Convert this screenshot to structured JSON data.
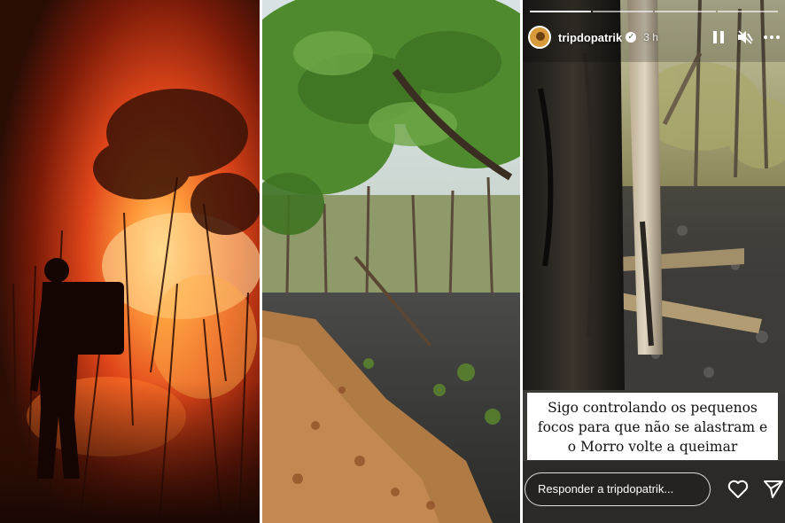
{
  "panels": {
    "left": {
      "subject": "firefighter-silhouette"
    },
    "middle": {
      "subject": "burned-woodland-path"
    },
    "right": {
      "subject": "instagram-story"
    }
  },
  "story": {
    "username": "tripdopatrik",
    "time_ago": "3 h",
    "caption_lines": [
      "Sigo controlando os pequenos",
      "focos para que não se alastram e",
      "o Morro volte a queimar"
    ],
    "reply_placeholder": "Responder a tripdopatrik...",
    "icons": {
      "pause": "pause-icon",
      "mute": "mute-icon",
      "more": "more-icon",
      "like": "heart-icon",
      "send": "send-icon"
    }
  },
  "colors": {
    "fire_orange": "#ff6a1a",
    "fire_glow": "#ffb347",
    "night": "#2a0d05",
    "leaf_green": "#4f8a2e",
    "ash": "#3b3b3b"
  }
}
